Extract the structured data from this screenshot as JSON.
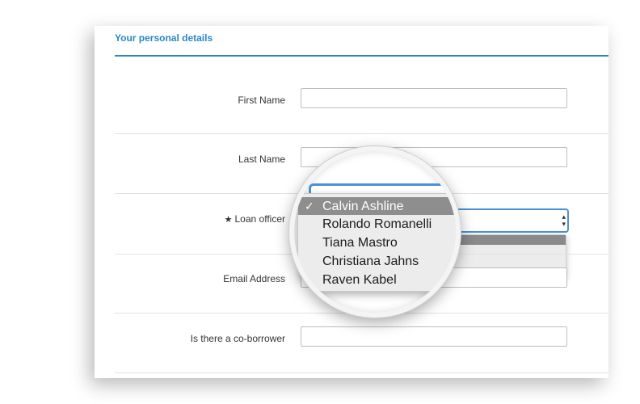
{
  "form": {
    "section_title": "Your personal details",
    "fields": {
      "first_name": {
        "label": "First Name",
        "value": ""
      },
      "last_name": {
        "label": "Last Name",
        "value": ""
      },
      "loan_officer": {
        "label": "Loan officer",
        "required_icon": "star-icon",
        "selected": "Calvin Ashline"
      },
      "email": {
        "label": "Email Address",
        "value": ""
      },
      "co_borrower": {
        "label": "Is there a co-borrower",
        "value": ""
      }
    }
  },
  "dropdown": {
    "check_mark": "✓",
    "options": [
      "Calvin Ashline",
      "Rolando Romanelli",
      "Tiana Mastro",
      "Christiana Jahns",
      "Raven Kabel"
    ]
  },
  "colors": {
    "accent": "#2a86c6",
    "focus_ring": "#4a90d9",
    "selected_option": "#8e8e8e"
  }
}
